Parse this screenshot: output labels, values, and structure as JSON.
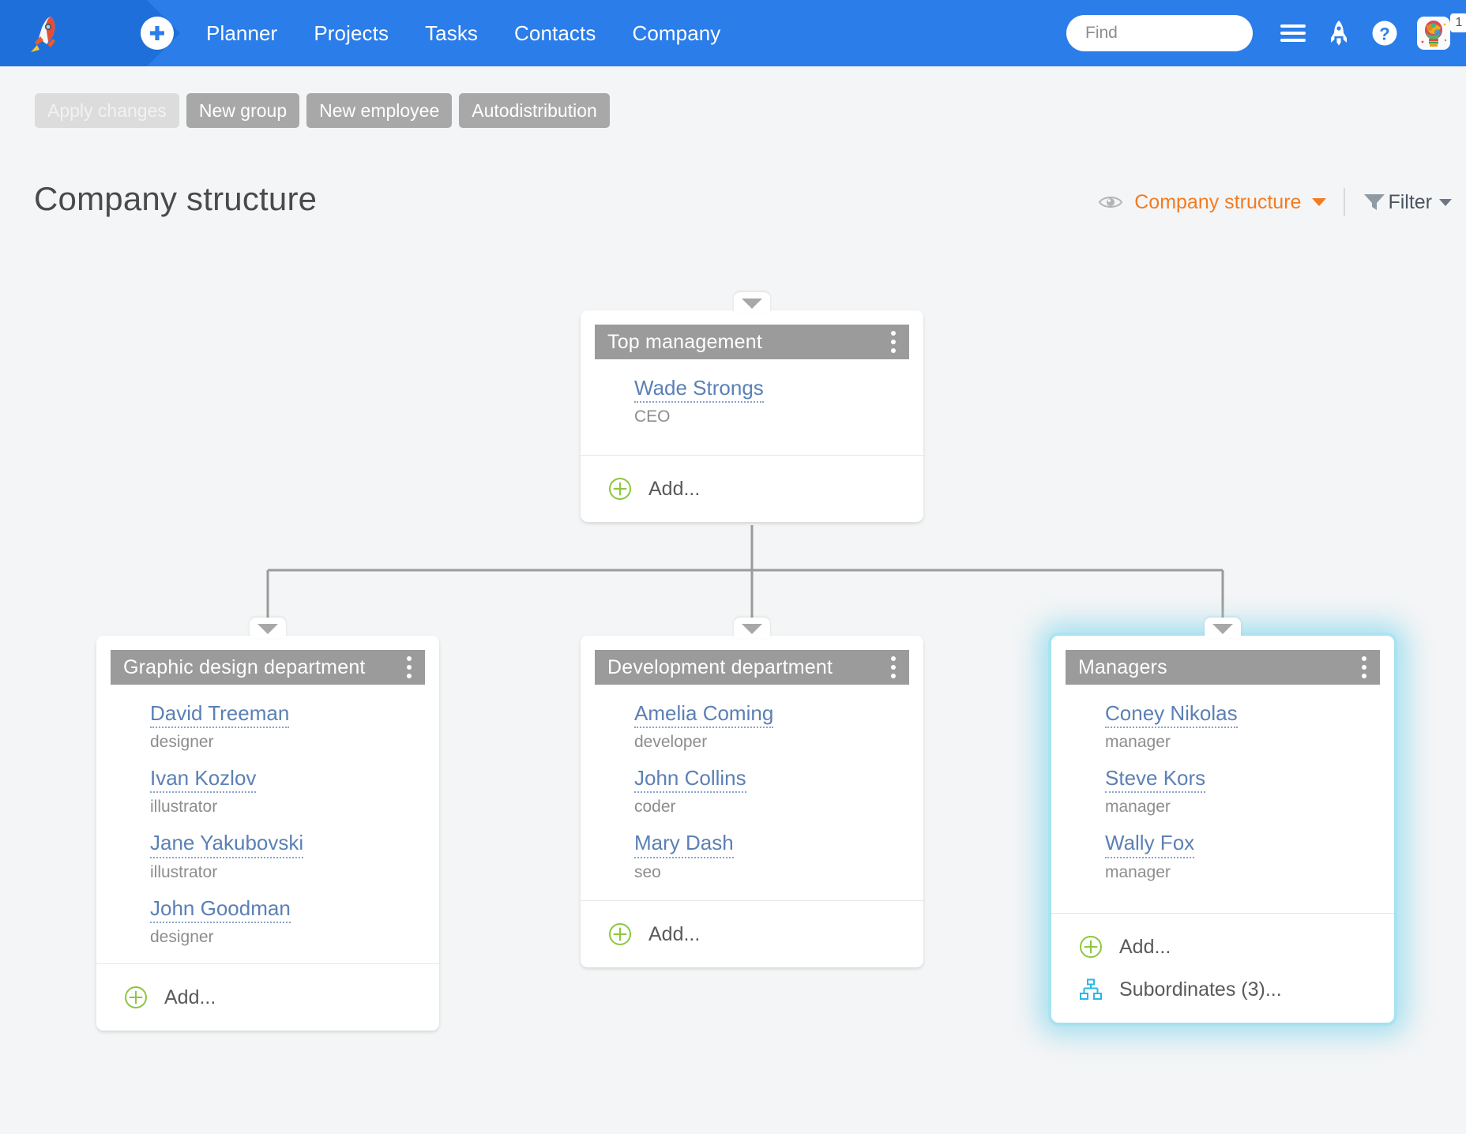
{
  "topbar": {
    "logo_icon": "rocket-logo",
    "add_icon": "plus-circle-icon",
    "nav": [
      {
        "label": "Planner"
      },
      {
        "label": "Projects"
      },
      {
        "label": "Tasks"
      },
      {
        "label": "Contacts"
      },
      {
        "label": "Company"
      }
    ],
    "search": {
      "placeholder": "Find",
      "value": "",
      "search_icon": "search-icon",
      "favorite_icon": "star-icon"
    },
    "icons": [
      {
        "name": "menu-icon"
      },
      {
        "name": "rocket-icon"
      },
      {
        "name": "help-icon"
      }
    ],
    "avatar_icon": "user-avatar",
    "notification_count": "1",
    "accent_color": "#2b7de9",
    "accent_dark_color": "#1e6fd9"
  },
  "toolbar": {
    "buttons": [
      {
        "label": "Apply changes",
        "disabled": true
      },
      {
        "label": "New group",
        "disabled": false
      },
      {
        "label": "New employee",
        "disabled": false
      },
      {
        "label": "Autodistribution",
        "disabled": false
      }
    ]
  },
  "page": {
    "title": "Company structure",
    "view_icon": "eye-icon",
    "view_label": "Company structure",
    "view_caret_icon": "chevron-down-icon",
    "filter_icon": "funnel-icon",
    "filter_label": "Filter",
    "filter_caret_icon": "chevron-down-icon",
    "accent_color": "#f47b20"
  },
  "org_chart": {
    "nodes": [
      {
        "id": "top-management",
        "title": "Top management",
        "people": [
          {
            "name": "Wade Strongs",
            "role": "CEO"
          }
        ],
        "actions": [
          {
            "label": "Add...",
            "icon": "plus-circle-green-icon"
          }
        ]
      },
      {
        "id": "graphic-design-department",
        "title": "Graphic design department",
        "people": [
          {
            "name": "David Treeman",
            "role": "designer"
          },
          {
            "name": "Ivan Kozlov",
            "role": "illustrator"
          },
          {
            "name": "Jane Yakubovski",
            "role": "illustrator"
          },
          {
            "name": "John Goodman",
            "role": "designer"
          }
        ],
        "actions": [
          {
            "label": "Add...",
            "icon": "plus-circle-green-icon"
          }
        ]
      },
      {
        "id": "development-department",
        "title": "Development department",
        "people": [
          {
            "name": "Amelia Coming",
            "role": "developer"
          },
          {
            "name": "John Collins",
            "role": "coder"
          },
          {
            "name": "Mary Dash",
            "role": "seo"
          }
        ],
        "actions": [
          {
            "label": "Add...",
            "icon": "plus-circle-green-icon"
          }
        ]
      },
      {
        "id": "managers",
        "title": "Managers",
        "highlighted": true,
        "people": [
          {
            "name": "Coney Nikolas",
            "role": "manager"
          },
          {
            "name": "Steve Kors",
            "role": "manager"
          },
          {
            "name": "Wally Fox",
            "role": "manager"
          }
        ],
        "actions": [
          {
            "label": "Add...",
            "icon": "plus-circle-green-icon"
          },
          {
            "label": "Subordinates (3)...",
            "icon": "org-tree-icon"
          }
        ]
      }
    ],
    "link_color": "#9b9b9b",
    "highlight_glow_color": "#96dcee",
    "header_color": "#9b9b9b",
    "person_link_color": "#5b80b5"
  }
}
